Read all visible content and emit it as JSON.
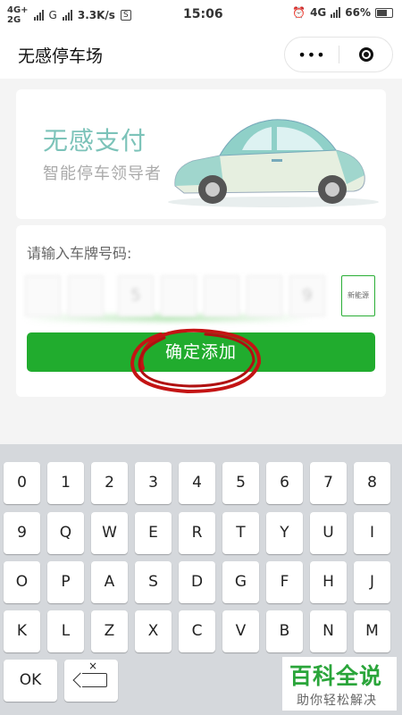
{
  "status_bar": {
    "network_top": "4G+",
    "network_bottom": "2G",
    "carrier_letter": "G",
    "speed": "3.3K/s",
    "s_badge": "S",
    "time": "15:06",
    "right_network": "4G",
    "battery": "66%"
  },
  "header": {
    "title": "无感停车场",
    "more_label": "•••"
  },
  "banner": {
    "title": "无感支付",
    "subtitle": "智能停车领导者"
  },
  "form": {
    "prompt": "请输入车牌号码:",
    "plate_chars": [
      "",
      "",
      "5",
      "",
      "",
      "",
      "9"
    ],
    "new_energy_label": "新能源",
    "confirm_label": "确定添加"
  },
  "keyboard": {
    "rows": [
      [
        "0",
        "1",
        "2",
        "3",
        "4",
        "5",
        "6",
        "7",
        "8"
      ],
      [
        "9",
        "Q",
        "W",
        "E",
        "R",
        "T",
        "Y",
        "U",
        "I"
      ],
      [
        "O",
        "P",
        "A",
        "S",
        "D",
        "G",
        "F",
        "H",
        "J"
      ],
      [
        "K",
        "L",
        "Z",
        "X",
        "C",
        "V",
        "B",
        "N",
        "M"
      ]
    ],
    "ok_label": "OK",
    "delete_glyph": "×"
  },
  "watermark": {
    "title": "百科全说",
    "subtitle": "助你轻松解决"
  },
  "colors": {
    "accent_green": "#21ac2e",
    "banner_teal": "#7cc3b9",
    "annotation_red": "#c41414"
  }
}
